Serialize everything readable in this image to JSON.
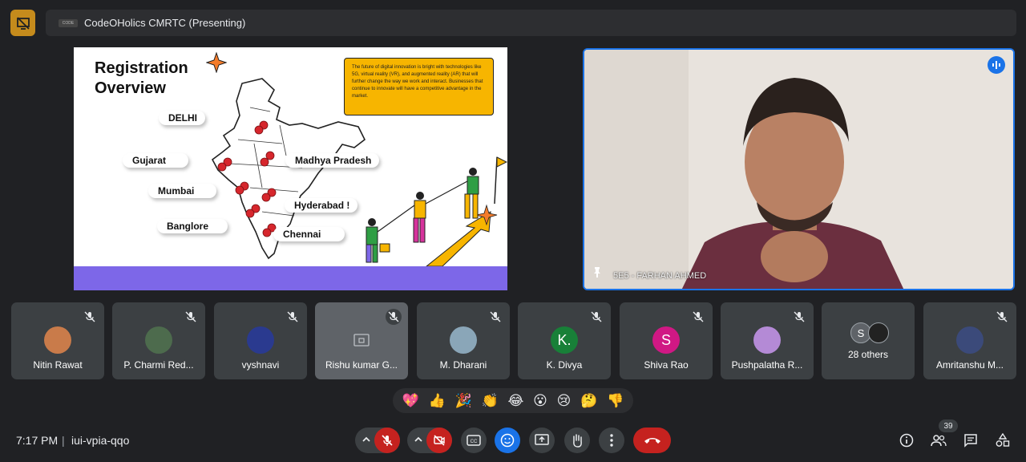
{
  "header": {
    "title": "CodeOHolics CMRTC (Presenting)"
  },
  "slide": {
    "heading_line1": "Registration",
    "heading_line2": "Overview",
    "info_text": "The future of digital innovation is bright with technologies like 5G, virtual reality (VR), and augmented reality (AR) that will further change the way we work and interact. Businesses that continue to innovate will have a competitive advantage in the market.",
    "cities": [
      "DELHI",
      "Gujarat",
      "Madhya Pradesh",
      "Mumbai",
      "Hyderabad !",
      "Banglore",
      "Chennai"
    ]
  },
  "speaker": {
    "name": "5E5 - FARHAN AHMED"
  },
  "participants": [
    {
      "name": "Nitin Rawat",
      "avatar_color": "#c97b4a"
    },
    {
      "name": "P. Charmi Red...",
      "avatar_color": "#4d6b4d"
    },
    {
      "name": "vyshnavi",
      "avatar_color": "#2a3a8f"
    },
    {
      "name": "Rishu kumar G...",
      "avatar_color": "#5f6368"
    },
    {
      "name": "M. Dharani",
      "avatar_color": "#8aa6b8"
    },
    {
      "name": "K. Divya",
      "avatar_letter": "K.",
      "avatar_color": "#188038"
    },
    {
      "name": "Shiva Rao",
      "avatar_letter": "S",
      "avatar_color": "#d01884"
    },
    {
      "name": "Pushpalatha R...",
      "avatar_color": "#b48ad6"
    },
    {
      "name": "28 others",
      "avatar_letter": "S",
      "avatar_color": "#5f6368"
    },
    {
      "name": "Amritanshu M...",
      "avatar_color": "#3b4a7a"
    }
  ],
  "reactions": [
    "💖",
    "👍",
    "🎉",
    "👏",
    "😂",
    "😮",
    "😢",
    "🤔",
    "👎"
  ],
  "footer": {
    "time": "7:17 PM",
    "meeting_code": "iui-vpia-qqo",
    "participant_count": "39"
  },
  "colors": {
    "background": "#202124",
    "tile": "#3c4043",
    "end_call": "#c5221f",
    "slide_footer": "#7d67e8",
    "info_box": "#f7b500"
  }
}
